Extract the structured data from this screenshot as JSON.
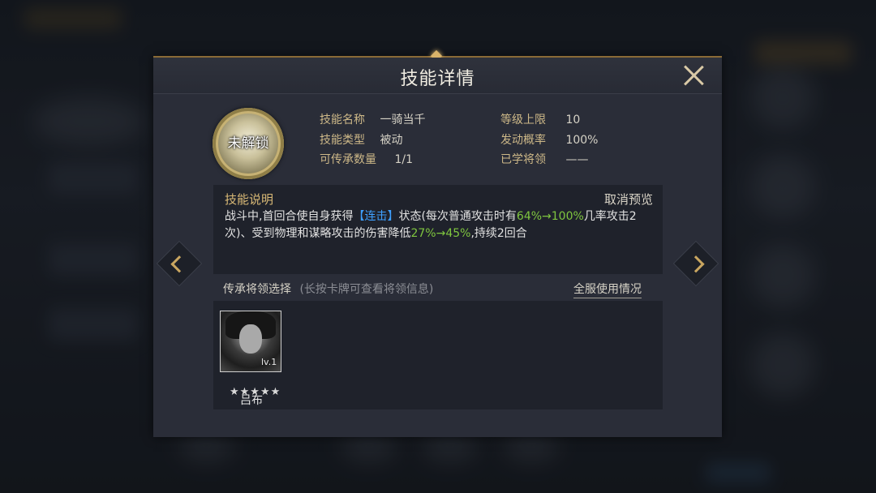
{
  "dialog": {
    "title": "技能详情",
    "close_icon": "close-icon"
  },
  "skill": {
    "icon": "skill-emblem-icon",
    "status": "未解锁",
    "name_label": "技能名称",
    "name": "一骑当千",
    "type_label": "技能类型",
    "type": "被动",
    "inherit_count_label": "可传承数量",
    "inherit_count": "1/1",
    "level_cap_label": "等级上限",
    "level_cap": "10",
    "trigger_rate_label": "发动概率",
    "trigger_rate": "100%",
    "learned_by_label": "已学将领",
    "learned_by": "——"
  },
  "description": {
    "title": "技能说明",
    "cancel_preview": "取消预览",
    "parts": {
      "p1": "战斗中,首回合使自身获得",
      "tag": "【连击】",
      "p2": "状态(每次普通攻击时有",
      "v1": "64%→100%",
      "p3": "几率攻击2次)、受到物理和谋略攻击的伤害降低",
      "v2": "27%→45%",
      "p4": ",持续2回合"
    }
  },
  "inherit": {
    "label": "传承将领选择",
    "hint": "(长按卡牌可查看将领信息)",
    "server_usage": "全服使用情况",
    "heroes": [
      {
        "name": "吕布",
        "level": "lv.1",
        "stars": "★★★★★"
      }
    ]
  },
  "nav": {
    "prev_icon": "chevron-left-icon",
    "next_icon": "chevron-right-icon"
  },
  "colors": {
    "accent_gold": "#cdb888",
    "highlight_blue": "#3fa0ff",
    "highlight_green": "#7fc63f",
    "panel_bg": "#2a2d38"
  }
}
